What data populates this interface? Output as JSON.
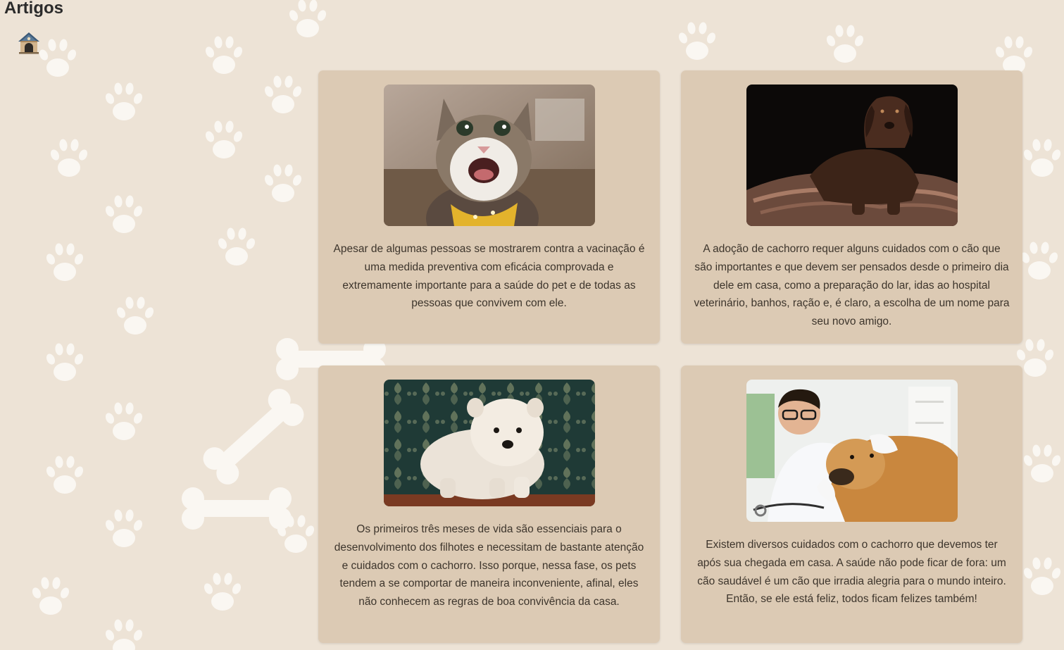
{
  "header": {
    "title": "Artigos",
    "home_icon": "doghouse-icon"
  },
  "background": {
    "pattern": "paw-print-and-bone",
    "base_color": "#ede3d6",
    "pattern_color": "#fbf8f4"
  },
  "colors": {
    "card_background": "#dccab4",
    "text": "#3d352c"
  },
  "articles": [
    {
      "image": "laughing-tabby-cat-with-yellow-bandana",
      "text": "Apesar de algumas pessoas se mostrarem contra a vacinação é uma medida preventiva com eficácia comprovada e extremamente importante para a saúde do pet e de todas as pessoas que convivem com ele."
    },
    {
      "image": "chocolate-labrador-lying-on-blanket",
      "text": "A adoção de cachorro requer alguns cuidados com o cão que são importantes e que devem ser pensados desde o primeiro dia dele em casa, como a preparação do lar, idas ao hospital veterinário, banhos, ração e, é claro, a escolha de um nome para seu novo amigo."
    },
    {
      "image": "fluffy-white-chow-chow-puppy",
      "text": "Os primeiros três meses de vida são essenciais para o desenvolvimento dos filhotes e necessitam de bastante atenção e cuidados com o cachorro. Isso porque, nessa fase, os pets tendem a se comportar de maneira inconveniente, afinal, eles não conhecem as regras de boa convivência da casa."
    },
    {
      "image": "veterinarian-examining-golden-dog",
      "text": "Existem diversos cuidados com o cachorro que devemos ter após sua chegada em casa. A saúde não pode ficar de fora: um cão saudável é um cão que irradia alegria para o mundo inteiro. Então, se ele está feliz, todos ficam felizes também!"
    }
  ]
}
